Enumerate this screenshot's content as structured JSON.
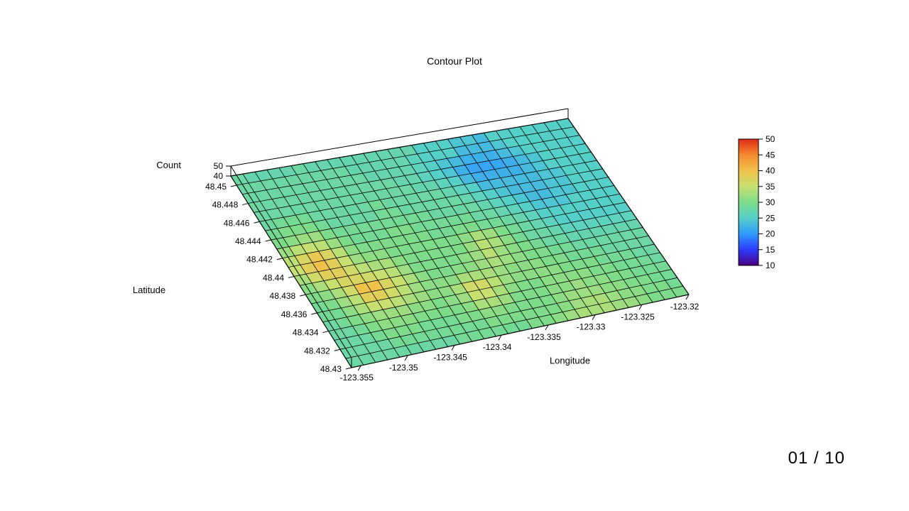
{
  "page_counter": "01 / 10",
  "chart_data": {
    "type": "heatmap",
    "title": "Contour Plot",
    "xlabel": "Longitude",
    "ylabel": "Latitude",
    "zlabel": "Count",
    "x_ticks": [
      -123.355,
      -123.35,
      -123.345,
      -123.34,
      -123.335,
      -123.33,
      -123.325,
      -123.32
    ],
    "y_ticks": [
      48.43,
      48.432,
      48.434,
      48.436,
      48.438,
      48.44,
      48.442,
      48.444,
      48.446,
      48.448,
      48.45
    ],
    "z_ticks": [
      40,
      50
    ],
    "color_scale": {
      "min": 10,
      "max": 50,
      "ticks": [
        10,
        15,
        20,
        25,
        30,
        35,
        40,
        45,
        50
      ]
    },
    "x_range": [
      -123.356,
      -123.32
    ],
    "y_range": [
      48.43,
      48.451
    ],
    "ncols": 28,
    "nrows": 21,
    "values": [
      [
        28,
        27,
        27,
        27,
        27,
        28,
        27,
        27,
        27,
        27,
        27,
        27,
        27,
        27,
        27,
        25,
        25,
        25,
        24,
        24,
        23,
        25,
        25,
        25,
        25,
        25,
        25,
        25
      ],
      [
        28,
        28,
        28,
        28,
        28,
        28,
        28,
        28,
        28,
        27,
        27,
        27,
        27,
        27,
        26,
        25,
        25,
        25,
        23,
        23,
        23,
        24,
        25,
        25,
        25,
        25,
        25,
        25
      ],
      [
        28,
        28,
        28,
        28,
        28,
        28,
        28,
        28,
        28,
        28,
        27,
        27,
        27,
        27,
        26,
        25,
        24,
        23,
        22,
        22,
        22,
        23,
        24,
        25,
        25,
        25,
        25,
        25
      ],
      [
        28,
        28,
        28,
        28,
        28,
        28,
        28,
        28,
        28,
        28,
        28,
        28,
        27,
        27,
        26,
        25,
        24,
        22,
        21,
        21,
        21,
        22,
        23,
        24,
        25,
        25,
        25,
        25
      ],
      [
        28,
        28,
        28,
        28,
        28,
        28,
        28,
        28,
        28,
        28,
        28,
        28,
        28,
        27,
        27,
        26,
        25,
        23,
        22,
        22,
        22,
        22,
        23,
        24,
        25,
        25,
        25,
        25
      ],
      [
        28,
        29,
        29,
        29,
        28,
        28,
        28,
        28,
        28,
        29,
        28,
        28,
        28,
        28,
        28,
        27,
        26,
        25,
        23,
        23,
        23,
        23,
        23,
        24,
        24,
        25,
        25,
        25
      ],
      [
        29,
        30,
        30,
        30,
        29,
        28,
        28,
        28,
        28,
        29,
        29,
        28,
        28,
        28,
        28,
        28,
        27,
        26,
        25,
        24,
        23,
        23,
        23,
        24,
        24,
        25,
        25,
        25
      ],
      [
        30,
        31,
        32,
        32,
        30,
        29,
        29,
        29,
        29,
        29,
        29,
        29,
        29,
        28,
        28,
        28,
        28,
        27,
        26,
        25,
        24,
        23,
        23,
        24,
        24,
        25,
        25,
        25
      ],
      [
        32,
        34,
        35,
        34,
        32,
        30,
        29,
        29,
        29,
        30,
        30,
        29,
        29,
        29,
        29,
        29,
        28,
        28,
        27,
        26,
        25,
        24,
        24,
        24,
        25,
        25,
        25,
        25
      ],
      [
        34,
        37,
        39,
        37,
        34,
        31,
        30,
        30,
        30,
        30,
        30,
        30,
        29,
        29,
        30,
        30,
        29,
        29,
        28,
        27,
        26,
        25,
        25,
        25,
        25,
        25,
        25,
        25
      ],
      [
        35,
        38,
        40,
        38,
        35,
        32,
        31,
        31,
        30,
        30,
        30,
        30,
        30,
        30,
        31,
        33,
        32,
        30,
        29,
        28,
        27,
        26,
        25,
        25,
        25,
        25,
        25,
        25
      ],
      [
        33,
        36,
        38,
        38,
        36,
        34,
        33,
        33,
        31,
        30,
        30,
        30,
        30,
        30,
        32,
        34,
        33,
        31,
        29,
        28,
        28,
        27,
        26,
        26,
        26,
        26,
        26,
        26
      ],
      [
        31,
        33,
        35,
        37,
        37,
        36,
        35,
        34,
        32,
        30,
        30,
        30,
        30,
        31,
        32,
        34,
        32,
        31,
        30,
        29,
        28,
        28,
        27,
        27,
        27,
        27,
        27,
        27
      ],
      [
        30,
        31,
        33,
        36,
        40,
        40,
        37,
        35,
        33,
        31,
        30,
        30,
        31,
        31,
        32,
        33,
        32,
        31,
        30,
        30,
        29,
        29,
        28,
        28,
        28,
        28,
        28,
        28
      ],
      [
        29,
        30,
        32,
        34,
        38,
        38,
        36,
        34,
        32,
        31,
        31,
        31,
        33,
        33,
        33,
        32,
        31,
        31,
        31,
        30,
        30,
        29,
        29,
        29,
        28,
        28,
        28,
        28
      ],
      [
        29,
        29,
        31,
        33,
        35,
        35,
        34,
        33,
        32,
        31,
        31,
        33,
        36,
        36,
        34,
        32,
        31,
        31,
        31,
        31,
        30,
        30,
        30,
        29,
        29,
        29,
        28,
        28
      ],
      [
        28,
        29,
        30,
        31,
        32,
        32,
        32,
        31,
        31,
        30,
        31,
        32,
        35,
        35,
        33,
        31,
        30,
        30,
        31,
        31,
        31,
        31,
        30,
        30,
        29,
        29,
        29,
        28
      ],
      [
        28,
        28,
        29,
        30,
        31,
        31,
        31,
        30,
        30,
        30,
        30,
        31,
        33,
        33,
        32,
        30,
        30,
        30,
        31,
        31,
        32,
        31,
        31,
        30,
        30,
        29,
        29,
        29
      ],
      [
        28,
        28,
        28,
        29,
        30,
        30,
        30,
        29,
        29,
        29,
        30,
        30,
        31,
        31,
        30,
        30,
        30,
        30,
        31,
        32,
        32,
        32,
        31,
        31,
        30,
        30,
        29,
        29
      ],
      [
        28,
        28,
        28,
        28,
        29,
        29,
        29,
        29,
        29,
        29,
        29,
        29,
        30,
        30,
        30,
        30,
        30,
        30,
        31,
        32,
        33,
        33,
        32,
        31,
        31,
        30,
        30,
        29
      ],
      [
        28,
        28,
        28,
        28,
        28,
        28,
        28,
        28,
        28,
        29,
        29,
        29,
        29,
        29,
        29,
        30,
        30,
        31,
        32,
        33,
        33,
        33,
        32,
        32,
        31,
        30,
        30,
        30
      ]
    ]
  }
}
